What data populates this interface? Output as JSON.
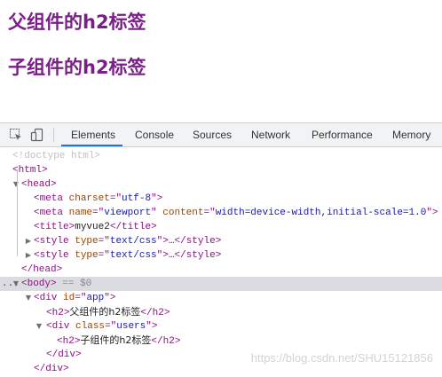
{
  "page": {
    "h2_parent": "父组件的h2标签",
    "h2_child": "子组件的h2标签",
    "heading_color": "#7a1f87"
  },
  "devtools": {
    "toolbar_icons": [
      "inspect-element-icon",
      "device-toolbar-icon"
    ],
    "tabs": [
      {
        "label": "Elements",
        "active": true
      },
      {
        "label": "Console",
        "active": false
      },
      {
        "label": "Sources",
        "active": false
      },
      {
        "label": "Network",
        "active": false
      },
      {
        "label": "Performance",
        "active": false
      },
      {
        "label": "Memory",
        "active": false
      }
    ],
    "accent_color": "#1a73e8",
    "dom": {
      "doctype": "<!doctype html>",
      "html_open": "<html>",
      "head_open": "<head>",
      "meta_charset": {
        "tag": "meta",
        "attr": "charset",
        "value": "utf-8"
      },
      "meta_viewport": {
        "tag": "meta",
        "attr1": "name",
        "value1": "viewport",
        "attr2": "content",
        "value2": "width=device-width,initial-scale=1.0"
      },
      "title": {
        "tag": "title",
        "text": "myvue2"
      },
      "style1": {
        "tag": "style",
        "attr": "type",
        "value": "text/css",
        "ellipsis": "…"
      },
      "style2": {
        "tag": "style",
        "attr": "type",
        "value": "text/css",
        "ellipsis": "…"
      },
      "head_close": "</head>",
      "body": {
        "tag": "body",
        "suffix": "== $0",
        "dots": "..."
      },
      "div_app": {
        "tag": "div",
        "attr": "id",
        "value": "app"
      },
      "h2_parent": {
        "tag": "h2",
        "text": "父组件的h2标签"
      },
      "div_users": {
        "tag": "div",
        "attr": "class",
        "value": "users"
      },
      "h2_child": {
        "tag": "h2",
        "text": "子组件的h2标签"
      },
      "div_close": "</div>"
    }
  },
  "watermark": "https://blog.csdn.net/SHU15121856"
}
